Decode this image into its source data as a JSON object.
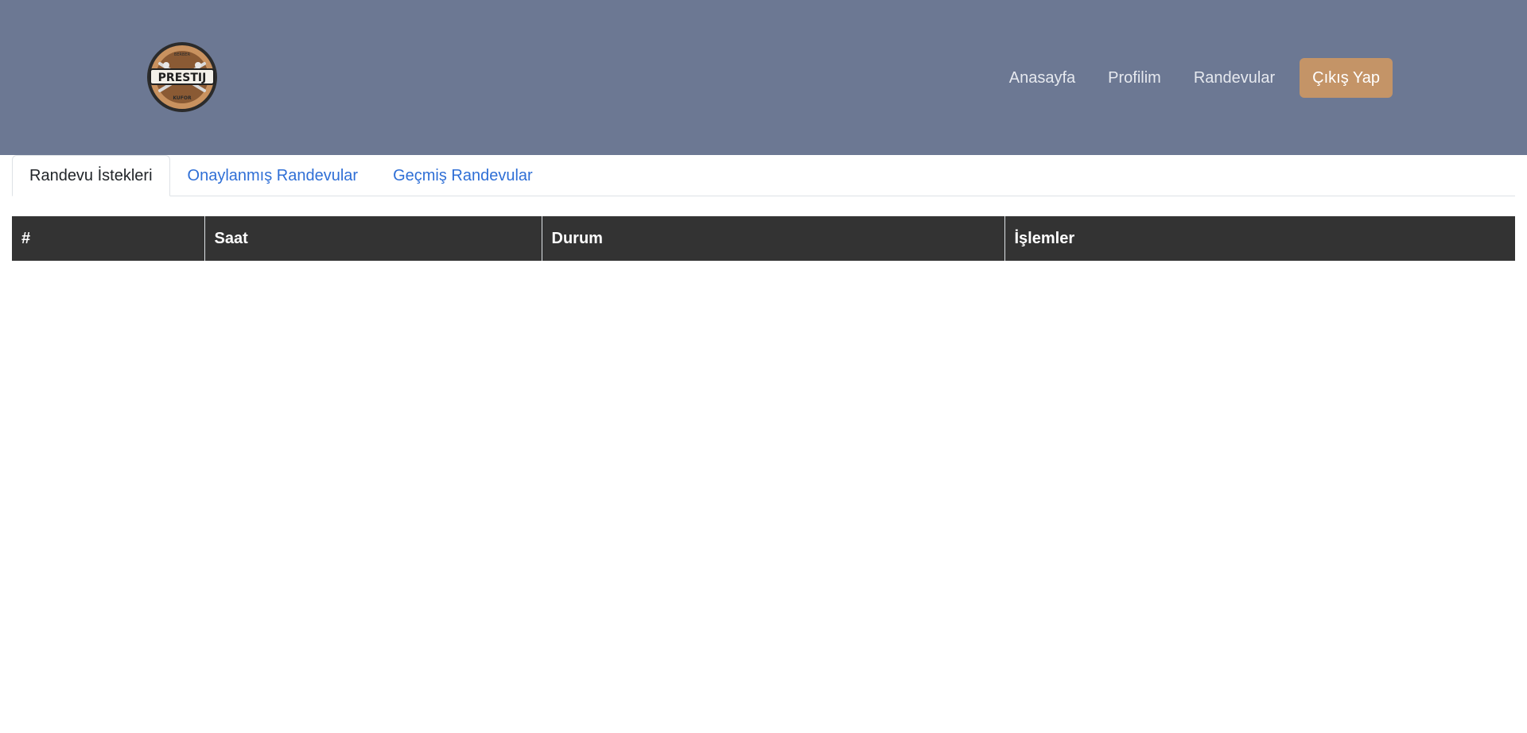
{
  "header": {
    "logo": {
      "top_text": "BERBER",
      "main_text": "PRESTIJ",
      "bottom_text": "KUFOR"
    },
    "nav": [
      {
        "label": "Anasayfa"
      },
      {
        "label": "Profilim"
      },
      {
        "label": "Randevular"
      }
    ],
    "logout_label": "Çıkış Yap"
  },
  "tabs": [
    {
      "label": "Randevu İstekleri",
      "active": true
    },
    {
      "label": "Onaylanmış Randevular",
      "active": false
    },
    {
      "label": "Geçmiş Randevular",
      "active": false
    }
  ],
  "table": {
    "columns": [
      "#",
      "Saat",
      "Durum",
      "İşlemler"
    ],
    "rows": []
  },
  "colors": {
    "header_bg": "#6c7893",
    "logout_bg": "#c49467",
    "tab_link": "#2f6fd6",
    "table_head_bg": "#333333"
  }
}
